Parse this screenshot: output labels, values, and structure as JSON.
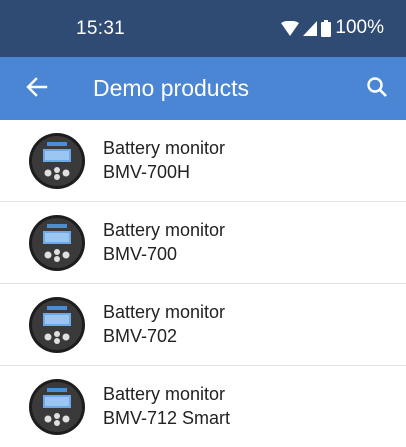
{
  "status_bar": {
    "time": "15:31",
    "battery_percent": "100%",
    "icons": [
      "wifi-icon",
      "cell-signal-icon",
      "battery-icon"
    ]
  },
  "app_bar": {
    "title": "Demo products",
    "back_icon": "arrow-left-icon",
    "search_icon": "search-icon"
  },
  "products": [
    {
      "line1": "Battery monitor",
      "line2": "BMV-700H",
      "icon": "battery-monitor-thumbnail"
    },
    {
      "line1": "Battery monitor",
      "line2": "BMV-700",
      "icon": "battery-monitor-thumbnail"
    },
    {
      "line1": "Battery monitor",
      "line2": "BMV-702",
      "icon": "battery-monitor-thumbnail"
    },
    {
      "line1": "Battery monitor",
      "line2": "BMV-712 Smart",
      "icon": "battery-monitor-thumbnail"
    }
  ],
  "colors": {
    "status_bar": "#2f4a73",
    "app_bar": "#4a86d4",
    "text": "#222222",
    "divider": "#e2e2e2"
  }
}
